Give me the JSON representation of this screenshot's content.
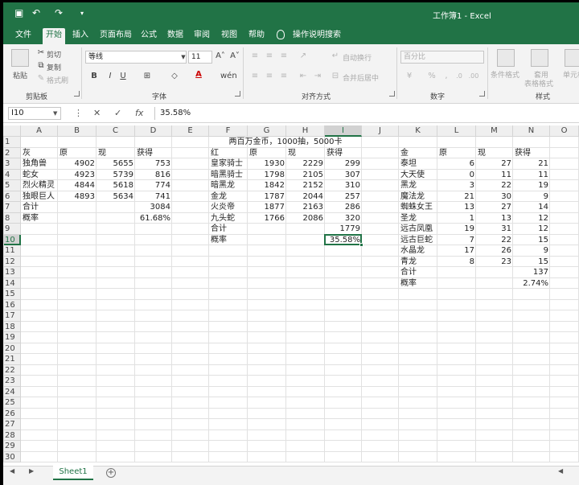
{
  "titlebar": {
    "title": "工作簿1 - Excel",
    "save_icon": "save-icon",
    "undo": "↶",
    "redo": "↷"
  },
  "tabs": [
    "文件",
    "开始",
    "插入",
    "页面布局",
    "公式",
    "数据",
    "审阅",
    "视图",
    "帮助"
  ],
  "tell_me": "操作说明搜索",
  "ribbon": {
    "clipboard": {
      "paste": "粘贴",
      "cut": "剪切",
      "copy": "复制",
      "painter": "格式刷",
      "label": "剪贴板"
    },
    "font": {
      "name": "等线",
      "size": "11",
      "grow": "A˄",
      "shrink": "A˅",
      "bold": "B",
      "italic": "I",
      "underline": "U",
      "label": "字体",
      "fontcolor_letter": "A"
    },
    "align": {
      "wrap": "自动换行",
      "merge": "合并后居中",
      "label": "对齐方式"
    },
    "number": {
      "format": "百分比",
      "pct": "%",
      "comma": ",",
      "label": "数字"
    },
    "styles": {
      "cond": "条件格式",
      "table1": "套用",
      "table2": "表格格式",
      "cell_style": "单元格",
      "label": "样式"
    }
  },
  "formula_bar": {
    "name_box": "I10",
    "cancel": "✕",
    "enter": "✓",
    "fx": "fx",
    "value": "35.58%"
  },
  "columns": [
    "A",
    "B",
    "C",
    "D",
    "E",
    "F",
    "G",
    "H",
    "I",
    "J",
    "K",
    "L",
    "M",
    "N",
    "O"
  ],
  "rows": [
    "1",
    "2",
    "3",
    "4",
    "5",
    "6",
    "7",
    "8",
    "9",
    "10",
    "11",
    "12",
    "13",
    "14",
    "15",
    "16",
    "17",
    "18",
    "19",
    "20",
    "21",
    "22",
    "23",
    "24",
    "25",
    "26",
    "27",
    "28",
    "29",
    "30"
  ],
  "selected": {
    "col": "I",
    "row": "10"
  },
  "cells": {
    "G1": "两百万金币，1000抽，5000卡",
    "A2": "灰",
    "B2": "原",
    "C2": "现",
    "D2": "获得",
    "A3": "独角兽",
    "B3": "4902",
    "C3": "5655",
    "D3": "753",
    "A4": "蛇女",
    "B4": "4923",
    "C4": "5739",
    "D4": "816",
    "A5": "烈火精灵",
    "B5": "4844",
    "C5": "5618",
    "D5": "774",
    "A6": "独眼巨人",
    "B6": "4893",
    "C6": "5634",
    "D6": "741",
    "A7": "合计",
    "D7": "3084",
    "A8": "概率",
    "D8": "61.68%",
    "F2": "红",
    "G2": "原",
    "H2": "现",
    "I2": "获得",
    "F3": "皇家骑士",
    "G3": "1930",
    "H3": "2229",
    "I3": "299",
    "F4": "暗黑骑士",
    "G4": "1798",
    "H4": "2105",
    "I4": "307",
    "F5": "暗黑龙",
    "G5": "1842",
    "H5": "2152",
    "I5": "310",
    "F6": "金龙",
    "G6": "1787",
    "H6": "2044",
    "I6": "257",
    "F7": "火炎帝",
    "G7": "1877",
    "H7": "2163",
    "I7": "286",
    "F8": "九头蛇",
    "G8": "1766",
    "H8": "2086",
    "I8": "320",
    "F9": "合计",
    "I9": "1779",
    "F10": "概率",
    "I10": "35.58%",
    "K2": "金",
    "L2": "原",
    "M2": "现",
    "N2": "获得",
    "K3": "泰坦",
    "L3": "6",
    "M3": "27",
    "N3": "21",
    "K4": "大天使",
    "L4": "0",
    "M4": "11",
    "N4": "11",
    "K5": "黑龙",
    "L5": "3",
    "M5": "22",
    "N5": "19",
    "K6": "魔法龙",
    "L6": "21",
    "M6": "30",
    "N6": "9",
    "K7": "蜘蛛女王",
    "L7": "13",
    "M7": "27",
    "N7": "14",
    "K8": "圣龙",
    "L8": "1",
    "M8": "13",
    "N8": "12",
    "K9": "远古凤凰",
    "L9": "19",
    "M9": "31",
    "N9": "12",
    "K10": "远古巨蛇",
    "L10": "7",
    "M10": "22",
    "N10": "15",
    "K11": "水晶龙",
    "L11": "17",
    "M11": "26",
    "N11": "9",
    "K12": "青龙",
    "L12": "8",
    "M12": "23",
    "N12": "15",
    "K13": "合计",
    "N13": "137",
    "K14": "概率",
    "N14": "2.74%"
  },
  "sheet_tab": "Sheet1",
  "add_sheet": "+"
}
